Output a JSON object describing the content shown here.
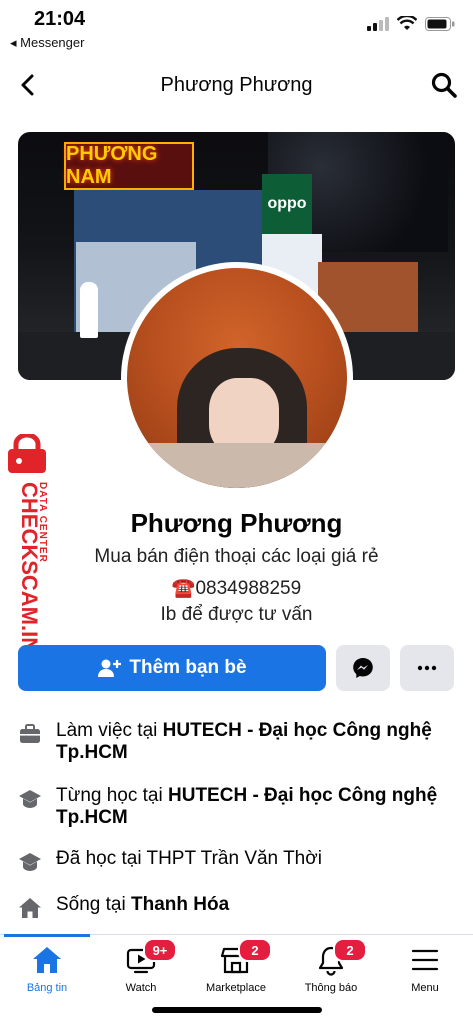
{
  "status_bar": {
    "time": "21:04",
    "back_app": "◂ Messenger"
  },
  "nav": {
    "title": "Phương Phương"
  },
  "cover": {
    "sign_red": "PHƯƠNG NAM",
    "sign_oppo": "oppo"
  },
  "profile": {
    "name": "Phương Phương",
    "bio_line1": "Mua bán điện thoại các loại giá rẻ",
    "bio_line2": "☎️0834988259",
    "bio_line3": "Ib để được tư vấn"
  },
  "actions": {
    "add_friend_label": "Thêm bạn bè"
  },
  "details": {
    "work": {
      "prefix": "Làm việc tại ",
      "place": "HUTECH - Đại học Công nghệ Tp.HCM"
    },
    "studied": {
      "prefix": "Từng học tại ",
      "place": "HUTECH - Đại học Công nghệ Tp.HCM"
    },
    "school": {
      "text": "Đã học tại THPT Trần Văn Thời"
    },
    "lives": {
      "prefix": "Sống tại ",
      "place": "Thanh Hóa"
    }
  },
  "watermark": {
    "brand": "CHECKSCAM.INFO",
    "sub": "DATA CENTER"
  },
  "tabbar": {
    "items": [
      {
        "label": "Bảng tin",
        "icon": "home-icon",
        "active": true
      },
      {
        "label": "Watch",
        "icon": "watch-icon",
        "badge": "9+"
      },
      {
        "label": "Marketplace",
        "icon": "marketplace-icon",
        "badge": "2"
      },
      {
        "label": "Thông báo",
        "icon": "bell-icon",
        "badge": "2"
      },
      {
        "label": "Menu",
        "icon": "menu-icon"
      }
    ]
  },
  "colors": {
    "accent": "#1b74e4",
    "badge": "#e41e3f",
    "watermark": "#e0242a"
  }
}
